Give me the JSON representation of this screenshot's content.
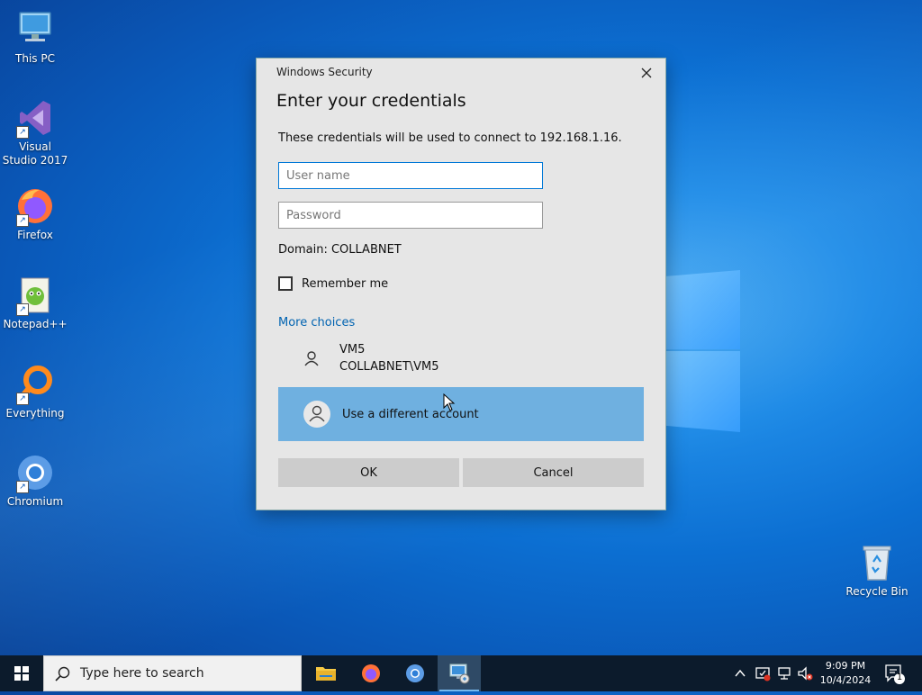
{
  "desktop": {
    "icons": [
      {
        "label": "This PC"
      },
      {
        "label": "Visual Studio 2017"
      },
      {
        "label": "Firefox"
      },
      {
        "label": "Notepad++"
      },
      {
        "label": "Everything"
      },
      {
        "label": "Chromium"
      },
      {
        "label": "Recycle Bin"
      }
    ]
  },
  "dialog": {
    "window_title": "Windows Security",
    "heading": "Enter your credentials",
    "description": "These credentials will be used to connect to 192.168.1.16.",
    "username_placeholder": "User name",
    "password_placeholder": "Password",
    "domain": "Domain: COLLABNET",
    "remember_label": "Remember me",
    "more_choices": "More choices",
    "accounts": [
      {
        "name": "VM5",
        "sub": "COLLABNET\\VM5"
      },
      {
        "name": "Use a different account"
      }
    ],
    "ok_label": "OK",
    "cancel_label": "Cancel"
  },
  "taskbar": {
    "search_placeholder": "Type here to search",
    "time": "9:09 PM",
    "date": "10/4/2024",
    "notification_count": "1"
  }
}
